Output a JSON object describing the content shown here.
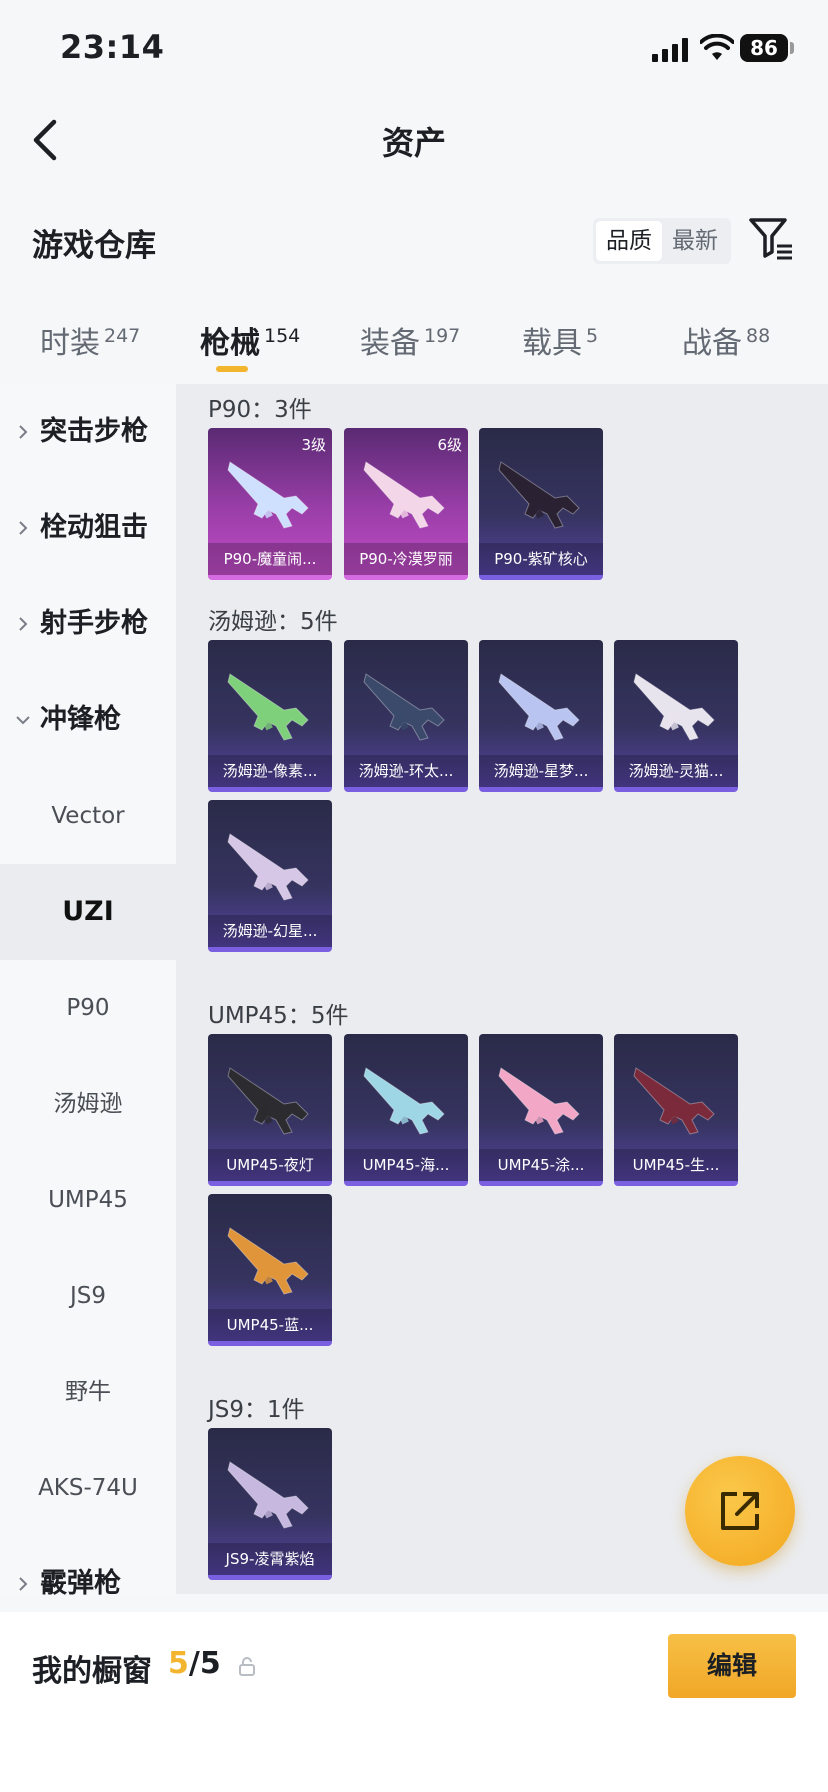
{
  "status_bar": {
    "time": "23:14",
    "battery": "86"
  },
  "header": {
    "title": "资产"
  },
  "section": {
    "title": "游戏仓库"
  },
  "sort": {
    "quality": "品质",
    "newest": "最新"
  },
  "tabs": [
    {
      "label": "时装",
      "count": "247"
    },
    {
      "label": "枪械",
      "count": "154"
    },
    {
      "label": "装备",
      "count": "197"
    },
    {
      "label": "载具",
      "count": "5"
    },
    {
      "label": "战备",
      "count": "88"
    }
  ],
  "sidebar": {
    "categories": [
      "突击步枪",
      "栓动狙击",
      "射手步枪",
      "冲锋枪",
      "霰弹枪"
    ],
    "subitems": [
      "Vector",
      "UZI",
      "P90",
      "汤姆逊",
      "UMP45",
      "JS9",
      "野牛",
      "AKS-74U"
    ]
  },
  "groups": [
    {
      "header": "P90：3件",
      "items": [
        {
          "name": "P90-魔童闹...",
          "grade": "3级",
          "rarity": "pink",
          "color": "#cfe0ff"
        },
        {
          "name": "P90-冷漠罗丽",
          "grade": "6级",
          "rarity": "pink",
          "color": "#f3d6e8"
        },
        {
          "name": "P90-紫矿核心",
          "grade": "",
          "rarity": "purple",
          "color": "#2a2233"
        }
      ]
    },
    {
      "header": "汤姆逊：5件",
      "items": [
        {
          "name": "汤姆逊-像素...",
          "grade": "",
          "rarity": "purple",
          "color": "#7ed07a"
        },
        {
          "name": "汤姆逊-环太...",
          "grade": "",
          "rarity": "purple",
          "color": "#3b4a6a"
        },
        {
          "name": "汤姆逊-星梦...",
          "grade": "",
          "rarity": "purple",
          "color": "#b9c4f0"
        },
        {
          "name": "汤姆逊-灵猫...",
          "grade": "",
          "rarity": "purple",
          "color": "#e8e4ee"
        },
        {
          "name": "汤姆逊-幻星...",
          "grade": "",
          "rarity": "purple",
          "color": "#d7c7e6"
        }
      ]
    },
    {
      "header": "UMP45：5件",
      "items": [
        {
          "name": "UMP45-夜灯",
          "grade": "",
          "rarity": "purple",
          "color": "#2b2b30"
        },
        {
          "name": "UMP45-海...",
          "grade": "",
          "rarity": "purple",
          "color": "#9fd6e6"
        },
        {
          "name": "UMP45-涂...",
          "grade": "",
          "rarity": "purple",
          "color": "#f2a7c6"
        },
        {
          "name": "UMP45-生...",
          "grade": "",
          "rarity": "purple",
          "color": "#7a2a3a"
        },
        {
          "name": "UMP45-蓝...",
          "grade": "",
          "rarity": "purple",
          "color": "#e0953a"
        }
      ]
    },
    {
      "header": "JS9：1件",
      "items": [
        {
          "name": "JS9-凌霄紫焰",
          "grade": "",
          "rarity": "purple",
          "color": "#c7b8e0"
        }
      ]
    }
  ],
  "bottom_bar": {
    "label": "我的橱窗",
    "current": "5",
    "total": "/5",
    "edit": "编辑"
  },
  "colors": {
    "accent": "#f4b52e",
    "card_purple": "#5443a0",
    "card_pink": "#c04cc6"
  },
  "icons": [
    "back-arrow-icon",
    "filter-icon",
    "chevron-right-icon",
    "chevron-down-icon",
    "share-icon",
    "lock-icon",
    "signal-icon",
    "wifi-icon",
    "battery-icon"
  ]
}
